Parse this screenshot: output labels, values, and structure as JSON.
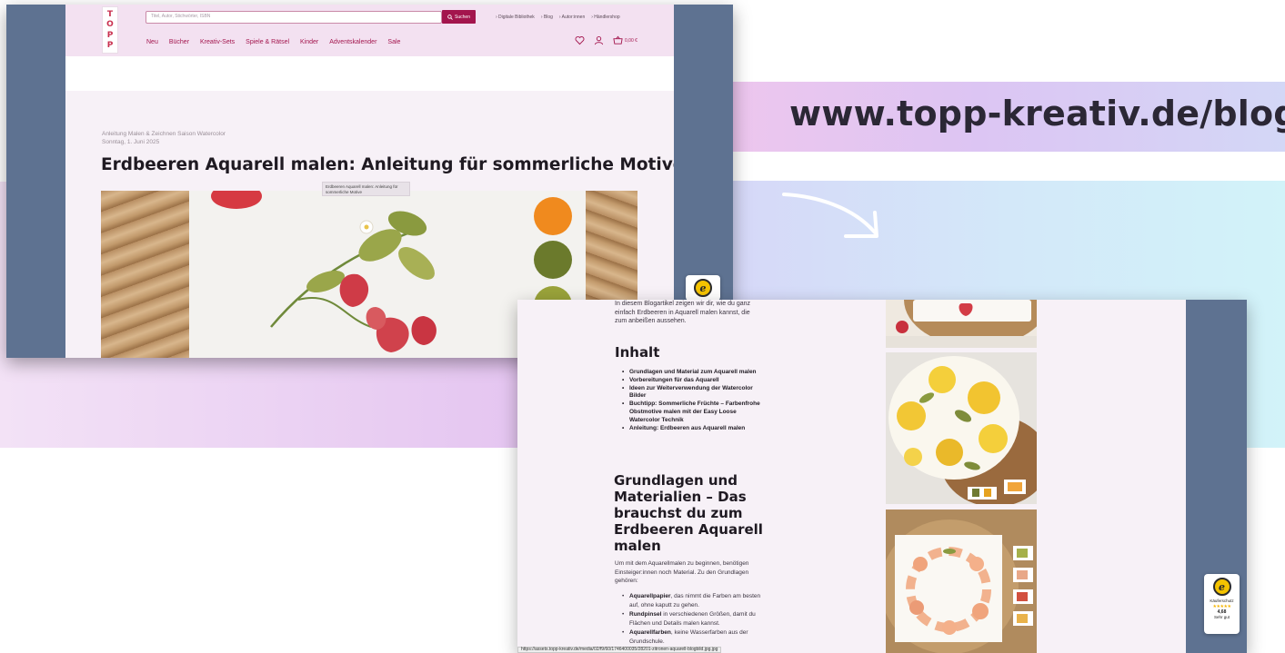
{
  "banner": {
    "url": "www.topp-kreativ.de/blog"
  },
  "screen1": {
    "logo": [
      "T",
      "O",
      "P",
      "P"
    ],
    "search": {
      "placeholder": "Titel, Autor, Stichwörter, ISBN",
      "button_label": "Suchen"
    },
    "top_links": [
      "› Digitale Bibliothek",
      "› Blog",
      "› Autor:innen",
      "› Händlershop"
    ],
    "nav": [
      "Neu",
      "Bücher",
      "Kreativ-Sets",
      "Spiele & Rätsel",
      "Kinder",
      "Adventskalender",
      "Sale"
    ],
    "cart_amount": "0,00 €",
    "breadcrumb": "Anleitung Malen & Zeichnen Saison Watercolor",
    "date": "Sonntag, 1. Juni 2025",
    "title": "Erdbeeren Aquarell malen: Anleitung für sommerliche Motive",
    "tooltip": "Erdbeeren Aquarell malen: Anleitung für sommerliche Motive"
  },
  "screen2": {
    "intro": "In diesem Blogartikel zeigen wir dir, wie du ganz einfach Erdbeeren in Aquarell malen kannst, die zum anbeißen aussehen.",
    "toc_heading": "Inhalt",
    "toc": [
      "Grundlagen und Material zum Aquarell malen",
      "Vorbereitungen für das Aquarell",
      "Ideen zur Weiterverwendung der Watercolor Bilder",
      "Buchtipp: Sommerliche Früchte – Farbenfrohe Obstmotive malen mit der Easy Loose Watercolor Technik",
      "Anleitung: Erdbeeren aus Aquarell malen"
    ],
    "section_heading": "Grundlagen und Materialien – Das brauchst du zum Erdbeeren Aquarell malen",
    "section_para": "Um mit dem Aquarellmalen zu beginnen, benötigen Einsteiger:innen noch Material. Zu den Grundlagen gehören:",
    "materials": [
      {
        "term": "Aquarellpapier",
        "text": ", das nimmt die Farben am besten auf, ohne kaputt zu gehen."
      },
      {
        "term": "Rundpinsel",
        "text": " in verschiedenen Größen, damit du Flächen und Details malen kannst."
      },
      {
        "term": "Aquarellfarben",
        "text": ", keine Wasserfarben aus der Grundschule."
      }
    ],
    "status_url": "https://assets.topp-kreativ.de/media/02/f9/60/1746400035/28201-zitronen-aquarell-blogbild.jpg.jpg",
    "badge": {
      "label": "Käuferschutz",
      "stars": "★★★★★",
      "score": "4,68",
      "rating": "Sehr gut"
    }
  },
  "colors": {
    "brand": "#a3154d",
    "frame": "#5e7291",
    "page_bg": "#f7f1f7"
  }
}
